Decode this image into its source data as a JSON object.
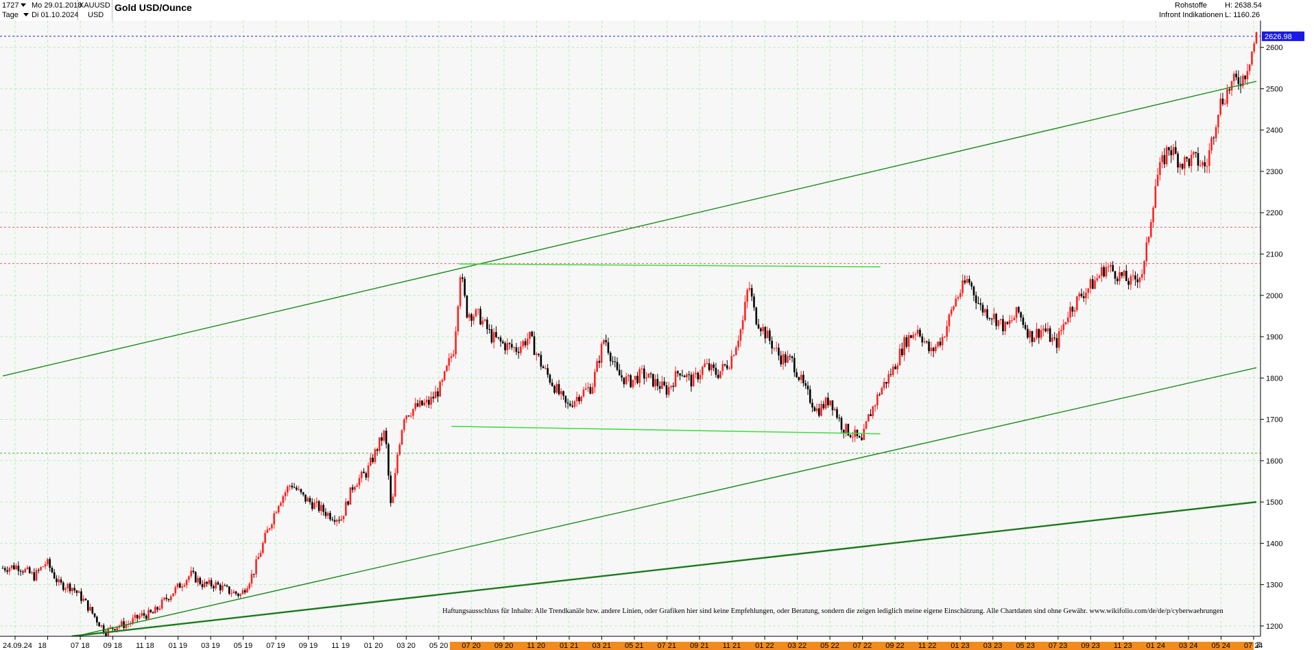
{
  "header": {
    "count": "1727",
    "from_date": "Mo 29.01.2018",
    "symbol": "XAUUSD",
    "interval": "Tage",
    "to_date": "Di 01.10.2024",
    "currency": "USD",
    "title": "Gold USD/Ounce",
    "category": "Rohstoffe",
    "source": "Infront Indikationen",
    "high": "H: 2638.54",
    "low": "L: 1160.26"
  },
  "chart_data": {
    "type": "candlestick",
    "ylim": [
      1175,
      2665
    ],
    "yticks": [
      1200,
      1300,
      1400,
      1500,
      1600,
      1700,
      1800,
      1900,
      2000,
      2100,
      2200,
      2300,
      2400,
      2500,
      2600
    ],
    "last_price": "2626.98",
    "x_tick_labels": [
      "24.09.24",
      "18",
      "07 18",
      "09 18",
      "11 18",
      "01 19",
      "03 19",
      "05 19",
      "07 19",
      "09 19",
      "11 19",
      "01 20",
      "03 20",
      "05 20",
      "07 20",
      "09 20",
      "11 20",
      "01 21",
      "03 21",
      "05 21",
      "07 21",
      "09 21",
      "11 21",
      "01 22",
      "03 22",
      "05 22",
      "07 22",
      "09 22",
      "11 22",
      "01 23",
      "03 23",
      "05 23",
      "07 23",
      "09 23",
      "11 23",
      "01 24",
      "03 24",
      "05 24",
      "07 24"
    ],
    "x_axis_end_label": "Z",
    "price_path": [
      [
        0,
        1340
      ],
      [
        0.012,
        1345
      ],
      [
        0.025,
        1320
      ],
      [
        0.035,
        1355
      ],
      [
        0.045,
        1300
      ],
      [
        0.055,
        1295
      ],
      [
        0.065,
        1260
      ],
      [
        0.075,
        1215
      ],
      [
        0.082,
        1185
      ],
      [
        0.09,
        1200
      ],
      [
        0.1,
        1205
      ],
      [
        0.11,
        1225
      ],
      [
        0.12,
        1230
      ],
      [
        0.13,
        1265
      ],
      [
        0.14,
        1295
      ],
      [
        0.15,
        1325
      ],
      [
        0.16,
        1300
      ],
      [
        0.17,
        1300
      ],
      [
        0.18,
        1285
      ],
      [
        0.19,
        1275
      ],
      [
        0.2,
        1330
      ],
      [
        0.21,
        1420
      ],
      [
        0.22,
        1500
      ],
      [
        0.23,
        1545
      ],
      [
        0.24,
        1510
      ],
      [
        0.25,
        1490
      ],
      [
        0.26,
        1470
      ],
      [
        0.27,
        1460
      ],
      [
        0.28,
        1545
      ],
      [
        0.29,
        1570
      ],
      [
        0.3,
        1640
      ],
      [
        0.305,
        1670
      ],
      [
        0.31,
        1470
      ],
      [
        0.315,
        1620
      ],
      [
        0.32,
        1710
      ],
      [
        0.33,
        1730
      ],
      [
        0.34,
        1740
      ],
      [
        0.35,
        1780
      ],
      [
        0.36,
        1875
      ],
      [
        0.365,
        2060
      ],
      [
        0.37,
        1960
      ],
      [
        0.38,
        1950
      ],
      [
        0.39,
        1900
      ],
      [
        0.4,
        1880
      ],
      [
        0.41,
        1870
      ],
      [
        0.42,
        1900
      ],
      [
        0.43,
        1830
      ],
      [
        0.44,
        1780
      ],
      [
        0.45,
        1730
      ],
      [
        0.46,
        1760
      ],
      [
        0.47,
        1780
      ],
      [
        0.48,
        1900
      ],
      [
        0.49,
        1810
      ],
      [
        0.5,
        1790
      ],
      [
        0.51,
        1810
      ],
      [
        0.52,
        1790
      ],
      [
        0.53,
        1770
      ],
      [
        0.54,
        1820
      ],
      [
        0.55,
        1790
      ],
      [
        0.56,
        1830
      ],
      [
        0.57,
        1810
      ],
      [
        0.58,
        1840
      ],
      [
        0.59,
        1930
      ],
      [
        0.595,
        2030
      ],
      [
        0.6,
        1950
      ],
      [
        0.61,
        1900
      ],
      [
        0.62,
        1850
      ],
      [
        0.63,
        1840
      ],
      [
        0.64,
        1770
      ],
      [
        0.65,
        1720
      ],
      [
        0.66,
        1750
      ],
      [
        0.67,
        1680
      ],
      [
        0.68,
        1660
      ],
      [
        0.685,
        1640
      ],
      [
        0.69,
        1700
      ],
      [
        0.7,
        1770
      ],
      [
        0.71,
        1820
      ],
      [
        0.72,
        1890
      ],
      [
        0.73,
        1920
      ],
      [
        0.74,
        1860
      ],
      [
        0.75,
        1900
      ],
      [
        0.76,
        1990
      ],
      [
        0.77,
        2040
      ],
      [
        0.78,
        1970
      ],
      [
        0.79,
        1950
      ],
      [
        0.8,
        1920
      ],
      [
        0.81,
        1960
      ],
      [
        0.82,
        1900
      ],
      [
        0.83,
        1920
      ],
      [
        0.84,
        1880
      ],
      [
        0.85,
        1960
      ],
      [
        0.86,
        2000
      ],
      [
        0.87,
        2030
      ],
      [
        0.88,
        2070
      ],
      [
        0.89,
        2050
      ],
      [
        0.9,
        2030
      ],
      [
        0.91,
        2060
      ],
      [
        0.92,
        2280
      ],
      [
        0.93,
        2360
      ],
      [
        0.94,
        2320
      ],
      [
        0.95,
        2330
      ],
      [
        0.96,
        2310
      ],
      [
        0.97,
        2460
      ],
      [
        0.98,
        2510
      ],
      [
        0.99,
        2530
      ],
      [
        1.0,
        2627
      ]
    ],
    "trendlines": [
      {
        "color": "#1a8a1a",
        "width": 1.4,
        "points": [
          [
            0,
            1805
          ],
          [
            1,
            2518
          ]
        ]
      },
      {
        "color": "#1a8a1a",
        "width": 1.4,
        "points": [
          [
            0.058,
            1175
          ],
          [
            1,
            1825
          ]
        ]
      },
      {
        "color": "#1a7a1a",
        "width": 2.4,
        "points": [
          [
            0.055,
            1175
          ],
          [
            1,
            1500
          ]
        ]
      },
      {
        "color": "#44dd44",
        "width": 1.6,
        "points": [
          [
            0.364,
            2076
          ],
          [
            0.7,
            2069
          ]
        ]
      },
      {
        "color": "#44dd44",
        "width": 1.6,
        "points": [
          [
            0.358,
            1683
          ],
          [
            0.7,
            1665
          ]
        ]
      }
    ],
    "h_lines": [
      {
        "value": 2627,
        "color": "#2222cc",
        "style": "dotted"
      },
      {
        "value": 2165,
        "color": "#e06060",
        "style": "dotted"
      },
      {
        "value": 2077,
        "color": "#e06060",
        "style": "dotted"
      },
      {
        "value": 1618,
        "color": "#44aa44",
        "style": "dotted"
      }
    ],
    "colors": {
      "candle_up": "#ff2020",
      "candle_down": "#000000",
      "grid": "#b9f0b9",
      "price_badge": "#1a1ae6"
    }
  },
  "disclaimer": "Haftungsausschluss für Inhalte: Alle Trendkanäle bzw. andere Linien, oder Grafiken hier sind keine Empfehlungen, oder Beratung, sondern die zeigen lediglich meine eigene Einschätzung. Alle Chartdaten sind ohne Gewähr.  www.wikifolio.com/de/de/p/cyberwaehrungen"
}
